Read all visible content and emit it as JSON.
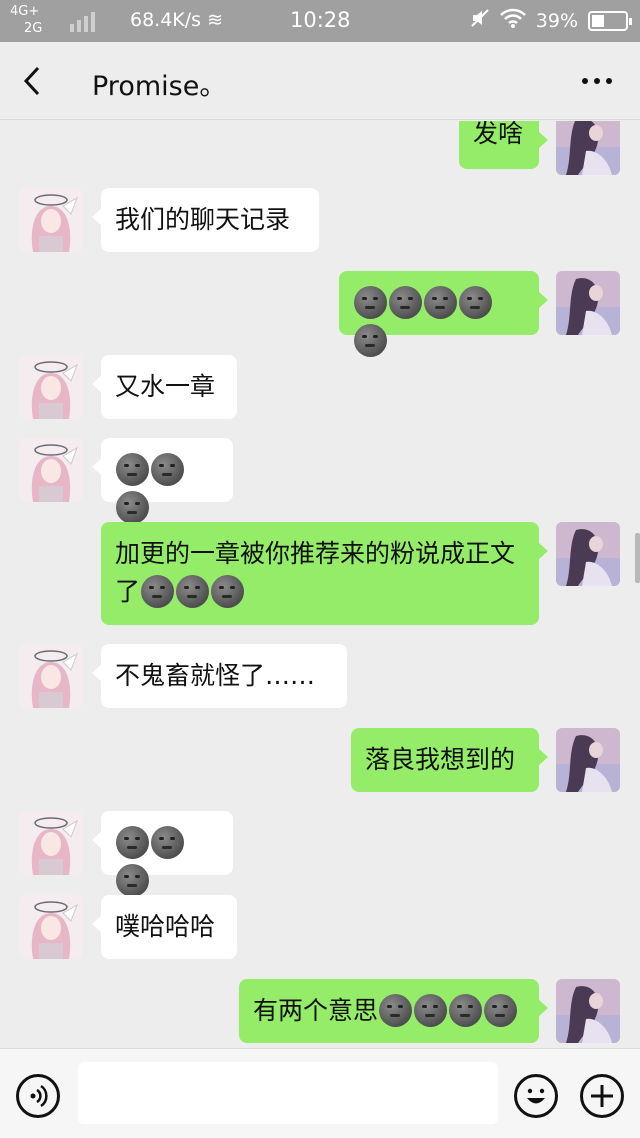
{
  "status_bar": {
    "network_top": "4G+",
    "network_bottom": "2G",
    "speed": "68.4K/s",
    "time": "10:28",
    "battery": "39%",
    "battery_level": 0.39
  },
  "header": {
    "title": "Promise。"
  },
  "messages": [
    {
      "side": "right",
      "text": "发啥",
      "moons": 0
    },
    {
      "side": "left",
      "text": "我们的聊天记录",
      "moons": 0
    },
    {
      "side": "right",
      "text": "",
      "moons": 5
    },
    {
      "side": "left",
      "text": "又水一章",
      "moons": 0
    },
    {
      "side": "left",
      "text": "",
      "moons": 3
    },
    {
      "side": "right",
      "text": "加更的一章被你推荐来的粉说成正文了",
      "moons": 3
    },
    {
      "side": "left",
      "text": "不鬼畜就怪了……",
      "moons": 0
    },
    {
      "side": "right",
      "text": "落良我想到的",
      "moons": 0
    },
    {
      "side": "left",
      "text": "",
      "moons": 3
    },
    {
      "side": "left",
      "text": "噗哈哈哈",
      "moons": 0
    },
    {
      "side": "right",
      "text": "有两个意思",
      "moons": 4
    }
  ],
  "emoji_name": "new-moon-face-emoji",
  "colors": {
    "right_bubble": "#95ec69",
    "left_bubble": "#ffffff",
    "background": "#ededed"
  }
}
